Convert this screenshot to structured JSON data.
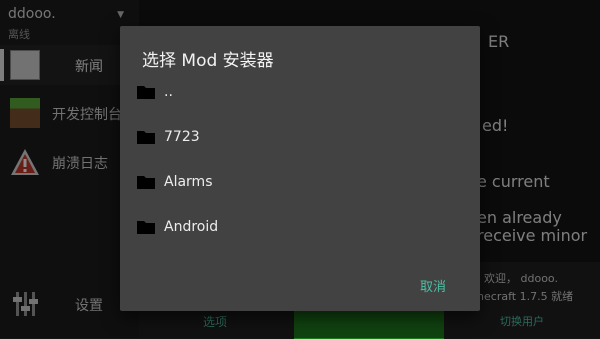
{
  "account": {
    "name": "ddooo.",
    "status": "离线"
  },
  "sidebar": {
    "items": [
      {
        "label": "新闻",
        "icon": "news-icon"
      },
      {
        "label": "开发控制台",
        "icon": "grass-block-icon"
      },
      {
        "label": "崩溃日志",
        "icon": "warning-icon"
      },
      {
        "label": "设置",
        "icon": "sliders-icon"
      }
    ]
  },
  "main": {
    "logo": "ER",
    "headline": "ed!",
    "paragraph_lines": [
      "e current",
      "en already",
      "receive minor"
    ]
  },
  "bottom": {
    "options_tab": "选项",
    "welcome": "欢迎， ddooo.",
    "minecraft_ready": "inecraft 1.7.5 就绪",
    "switch_user": "切换用户"
  },
  "dialog": {
    "title": "选择 Mod 安装器",
    "files": [
      "..",
      "7723",
      "Alarms",
      "Android"
    ],
    "cancel_label": "取消"
  },
  "colors": {
    "accent": "#4fbfa3",
    "dialog_bg": "#424242",
    "play_button": "#1e7a1e"
  }
}
